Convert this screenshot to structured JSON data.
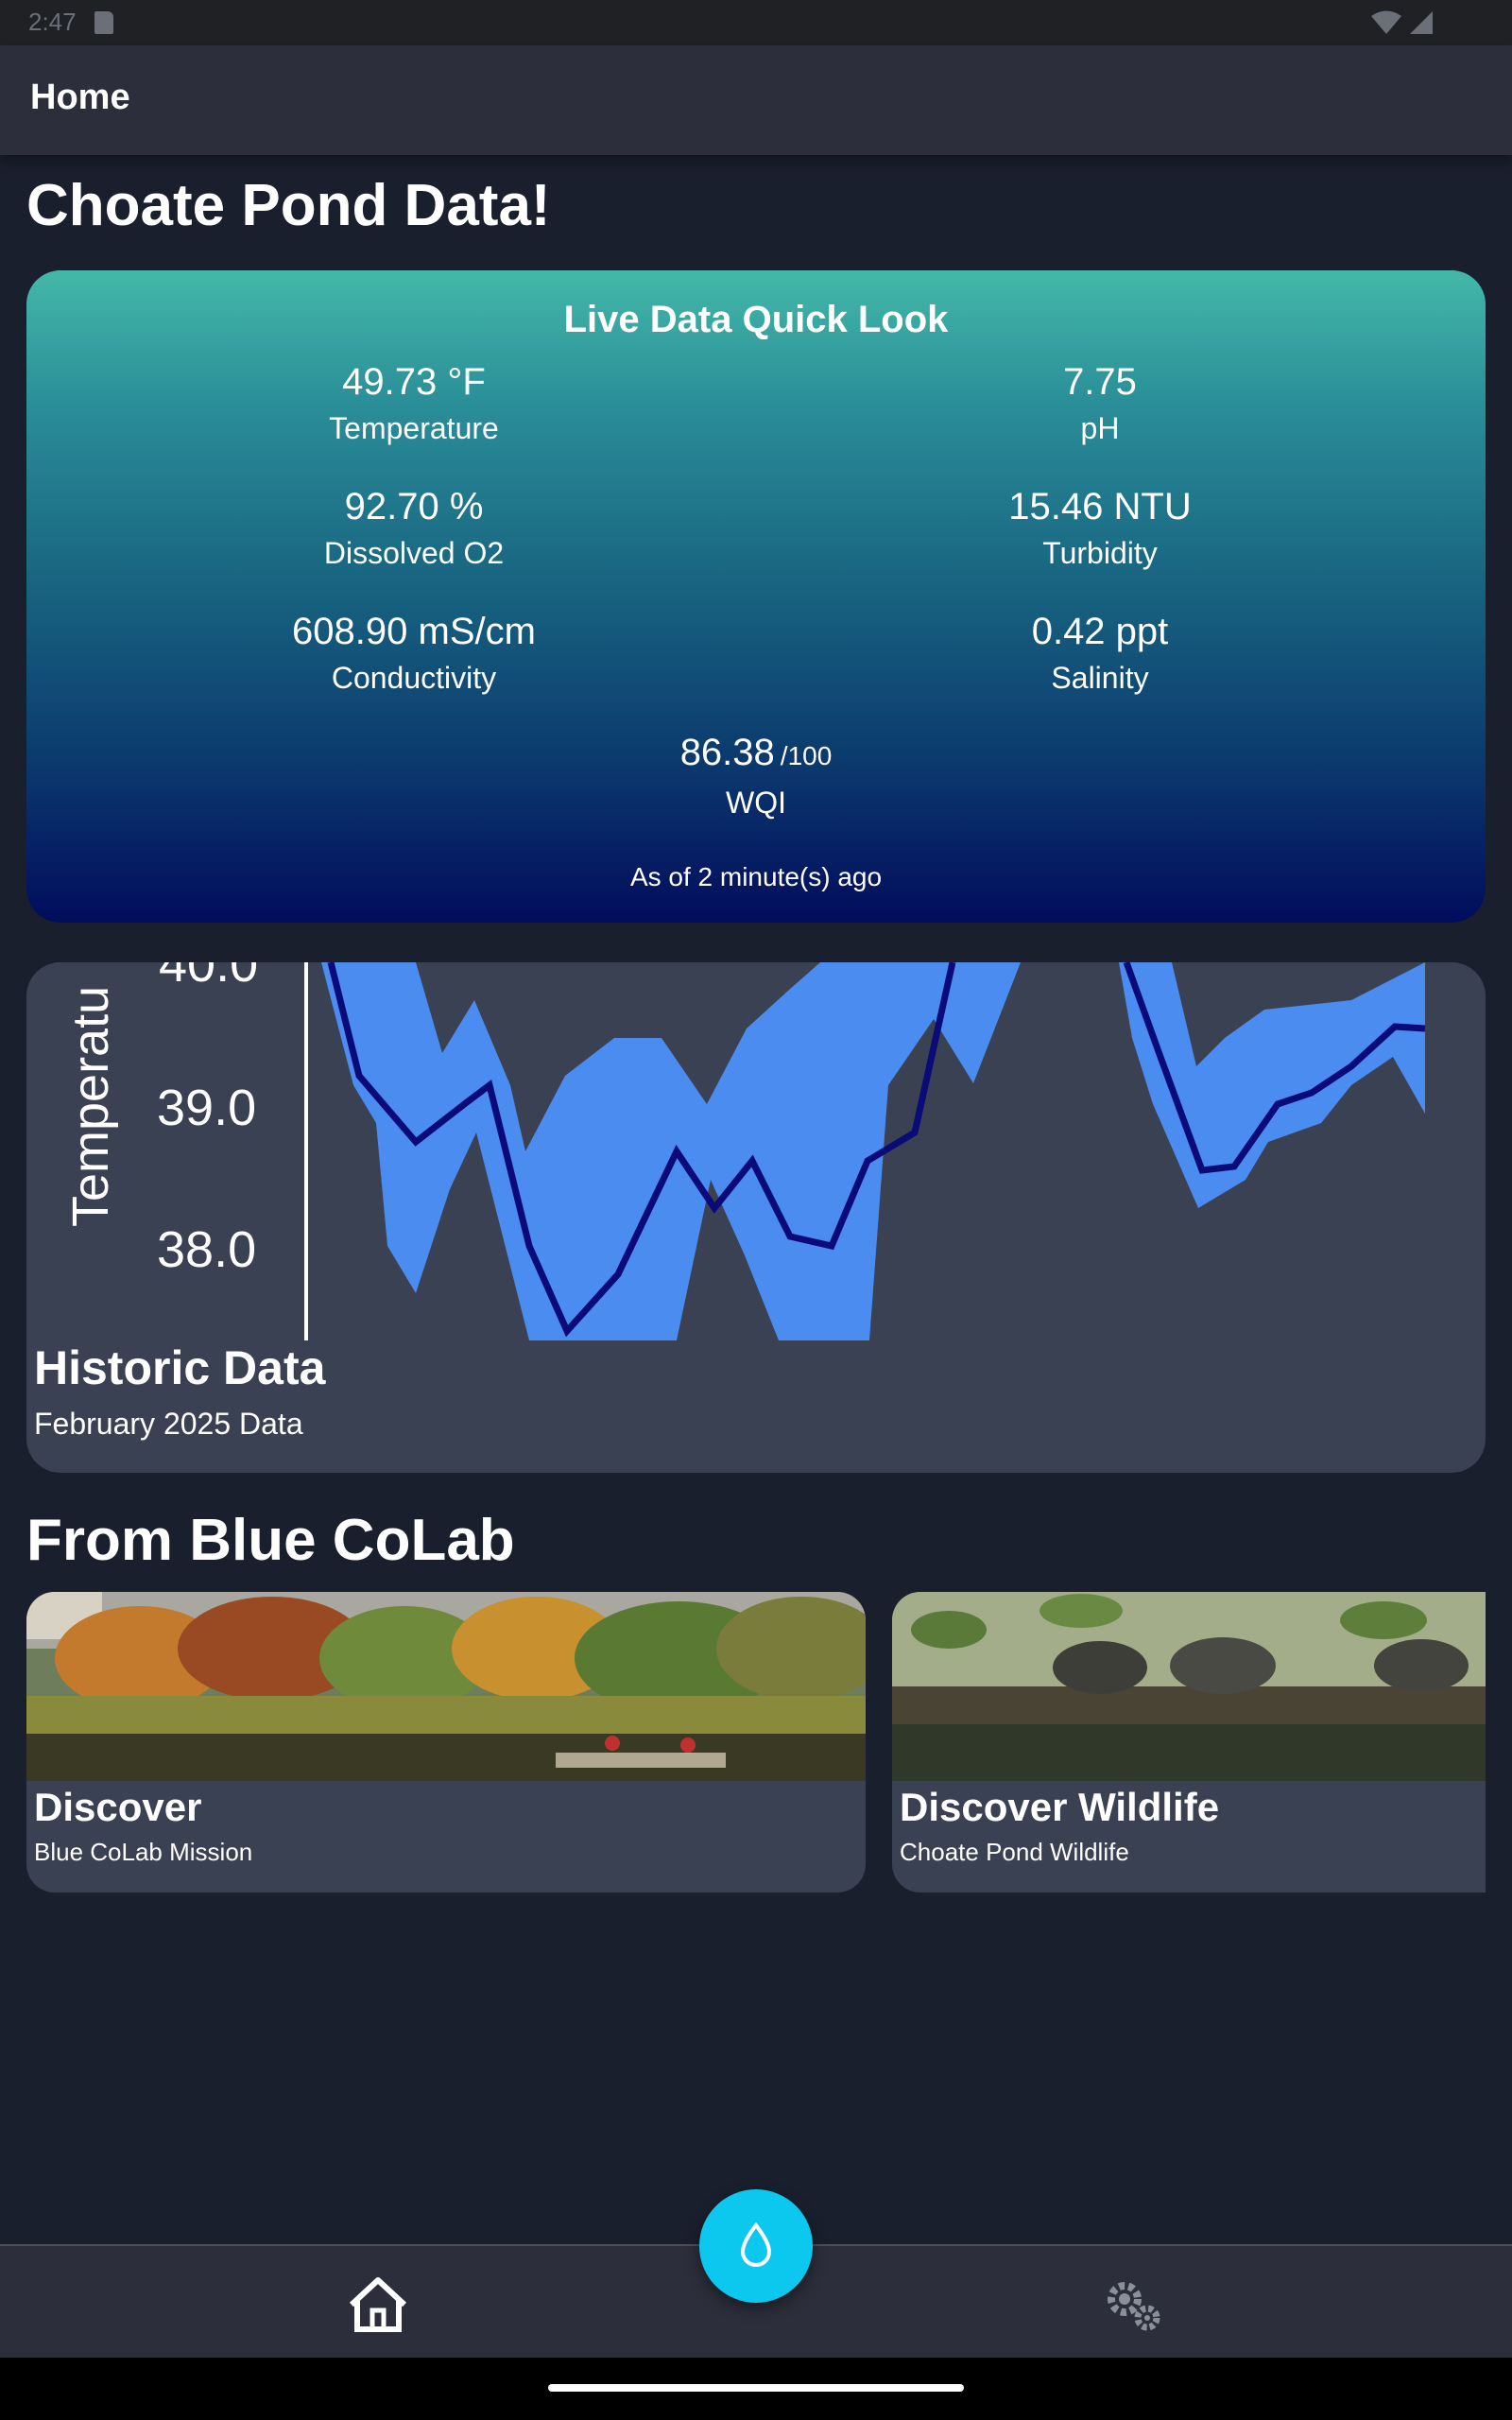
{
  "status_bar": {
    "time": "2:47"
  },
  "app_bar": {
    "title": "Home"
  },
  "page": {
    "title": "Choate Pond Data!"
  },
  "live_card": {
    "title": "Live Data Quick Look",
    "metrics": [
      {
        "value": "49.73 °F",
        "label": "Temperature"
      },
      {
        "value": "7.75",
        "label": "pH"
      },
      {
        "value": "92.70 %",
        "label": "Dissolved O2"
      },
      {
        "value": "15.46 NTU",
        "label": "Turbidity"
      },
      {
        "value": "608.90 mS/cm",
        "label": "Conductivity"
      },
      {
        "value": "0.42 ppt",
        "label": "Salinity"
      }
    ],
    "wqi": {
      "value": "86.38",
      "max": "/100",
      "label": "WQI"
    },
    "updated": "As of 2 minute(s) ago"
  },
  "historic_card": {
    "title": "Historic Data",
    "subtitle": "February 2025 Data",
    "chart_preview": {
      "axis_label": "Temperatu",
      "tick_labels": [
        "40.0",
        "39.0",
        "38.0"
      ]
    }
  },
  "section": {
    "title": "From Blue CoLab"
  },
  "discover_cards": [
    {
      "title": "Discover",
      "subtitle": "Blue CoLab Mission"
    },
    {
      "title": "Discover Wildlife",
      "subtitle": "Choate Pond Wildlife"
    }
  ],
  "bottom_nav": {
    "items": [
      "home-icon",
      "settings-icon"
    ],
    "fab_icon": "water-drop-icon"
  },
  "colors": {
    "accent": "#0cc8ee",
    "card": "#3a4152",
    "background": "#1a1f2d",
    "chart_band": "#4a8cf0",
    "chart_line": "#0a0a78"
  }
}
